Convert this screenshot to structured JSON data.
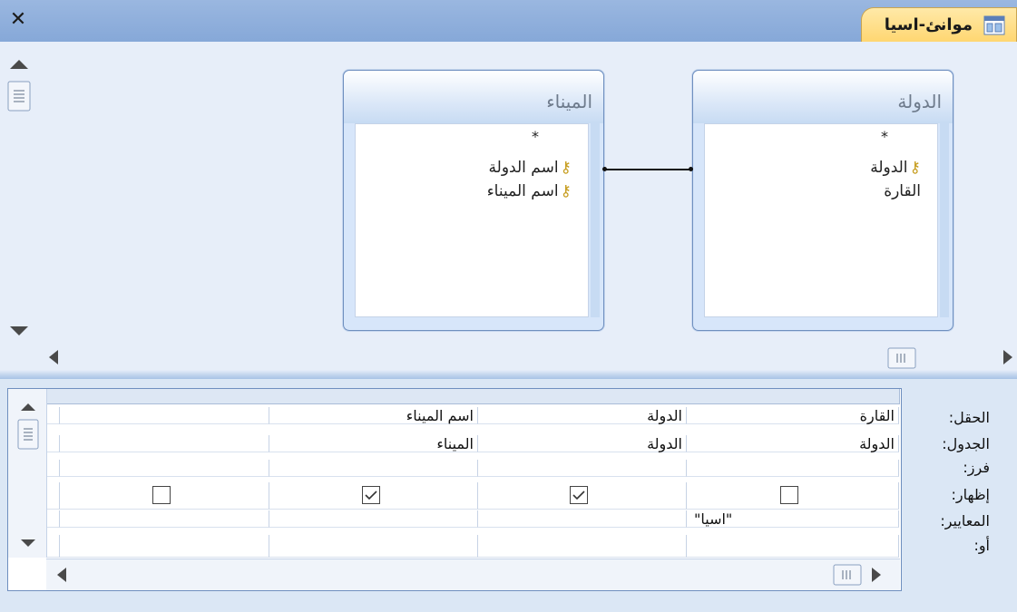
{
  "window": {
    "title": "موانئ-اسيا",
    "close_symbol": "✕"
  },
  "design": {
    "tables": [
      {
        "name": "الدولة",
        "star": "*",
        "fields": [
          {
            "label": "الدولة",
            "key": true
          },
          {
            "label": "القارة",
            "key": false
          }
        ]
      },
      {
        "name": "الميناء",
        "star": "*",
        "fields": [
          {
            "label": "اسم الدولة",
            "key": true
          },
          {
            "label": "اسم الميناء",
            "key": true
          }
        ]
      }
    ]
  },
  "grid": {
    "row_labels": [
      "الحقل:",
      "الجدول:",
      "فرز:",
      "إظهار:",
      "المعايير:",
      "أو:"
    ],
    "columns": [
      {
        "field": "القارة",
        "table": "الدولة",
        "sort": "",
        "show": false,
        "criteria": "\"اسيا\"",
        "or": ""
      },
      {
        "field": "الدولة",
        "table": "الدولة",
        "sort": "",
        "show": true,
        "criteria": "",
        "or": ""
      },
      {
        "field": "اسم الميناء",
        "table": "الميناء",
        "sort": "",
        "show": true,
        "criteria": "",
        "or": ""
      },
      {
        "field": "",
        "table": "",
        "sort": "",
        "show": false,
        "criteria": "",
        "or": ""
      }
    ]
  },
  "icons": {
    "close": "close-icon",
    "query": "query-icon",
    "key": "primary-key-icon",
    "checkmark": "checkmark-icon"
  },
  "colors": {
    "tab_accent": "#ffd670",
    "header": "#86a8d8",
    "key": "#c69c1d"
  }
}
